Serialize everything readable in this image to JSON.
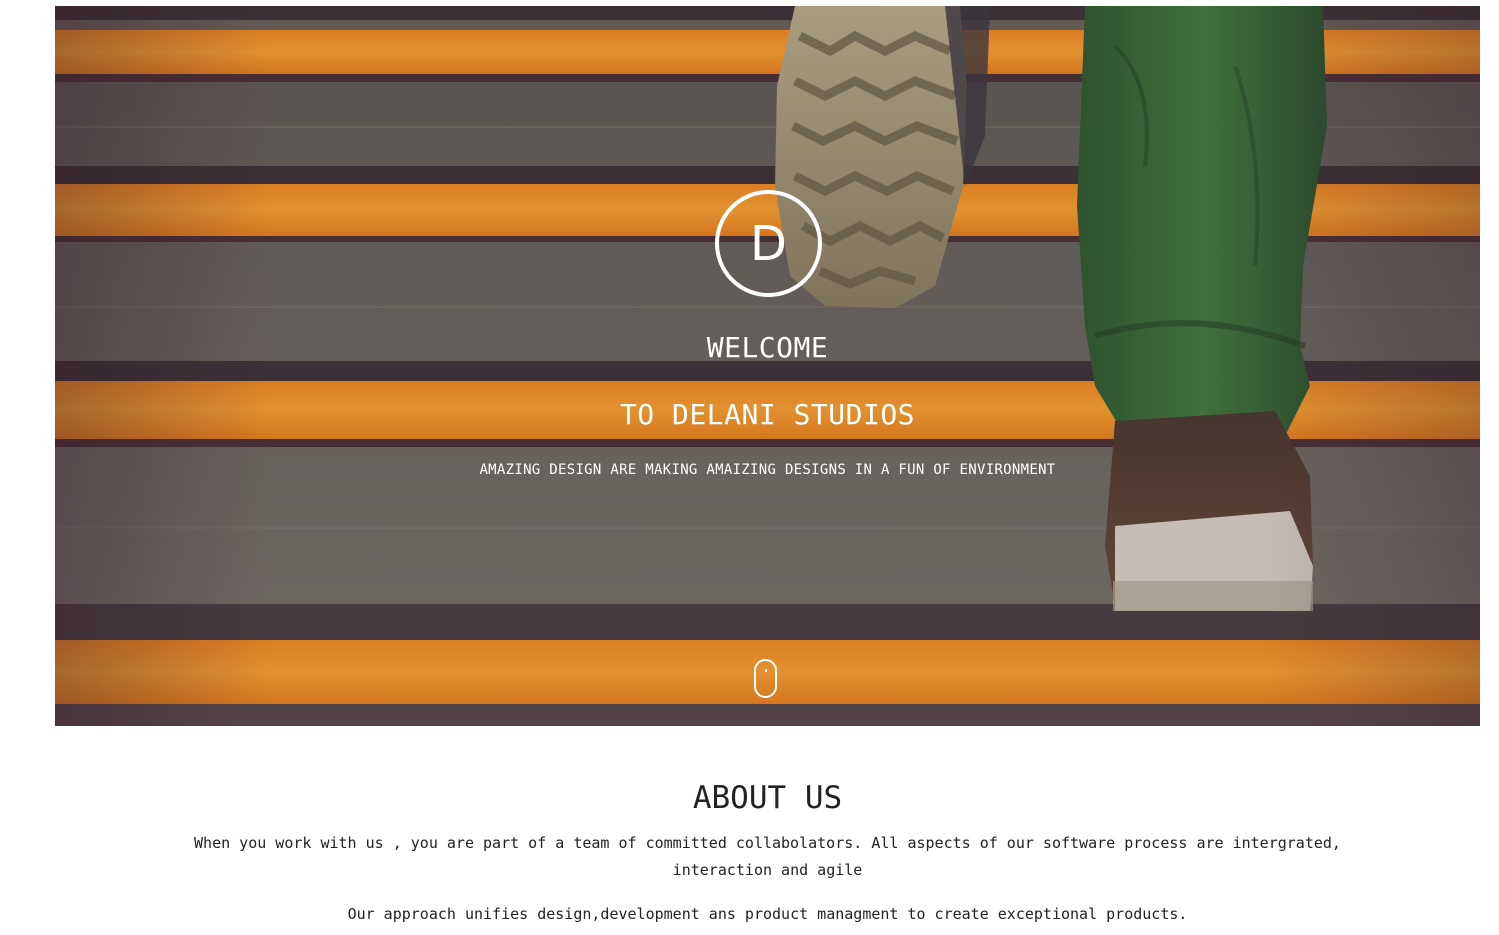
{
  "hero": {
    "logo_letter": "D",
    "welcome": "WELCOME",
    "studios": "TO DELANI STUDIOS",
    "tagline": "AMAZING DESIGN ARE MAKING AMAIZING DESIGNS IN A FUN OF ENVIRONMENT",
    "scroll_icon": "mouse-scroll-icon"
  },
  "about": {
    "title": "ABOUT US",
    "paragraph_1": "When you work with us , you are part of a team of committed collabolators. All aspects of our software process are intergrated, interaction and agile",
    "paragraph_2": "Our approach unifies design,development ans product managment to create exceptional products."
  },
  "colors": {
    "stripe_orange": "#f4962a",
    "step_gray": "#6f6b65",
    "pants_green": "#3d6d3a",
    "text_dark": "#222222",
    "hero_text": "#ffffff"
  }
}
